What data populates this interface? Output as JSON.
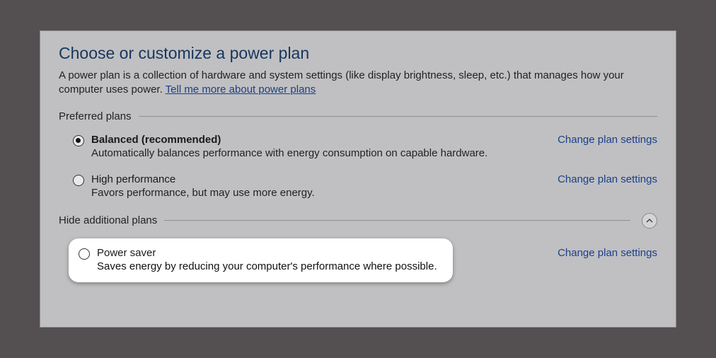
{
  "title": "Choose or customize a power plan",
  "intro": {
    "text_before_link": "A power plan is a collection of hardware and system settings (like display brightness, sleep, etc.) that manages how your computer uses power. ",
    "link_text": "Tell me more about power plans"
  },
  "sections": {
    "preferred": {
      "label": "Preferred plans",
      "plans": [
        {
          "name": "Balanced (recommended)",
          "desc": "Automatically balances performance with energy consumption on capable hardware.",
          "selected": true,
          "change_label": "Change plan settings"
        },
        {
          "name": "High performance",
          "desc": "Favors performance, but may use more energy.",
          "selected": false,
          "change_label": "Change plan settings"
        }
      ]
    },
    "additional": {
      "label": "Hide additional plans",
      "plans": [
        {
          "name": "Power saver",
          "desc": "Saves energy by reducing your computer's performance where possible.",
          "selected": false,
          "change_label": "Change plan settings"
        }
      ]
    }
  }
}
